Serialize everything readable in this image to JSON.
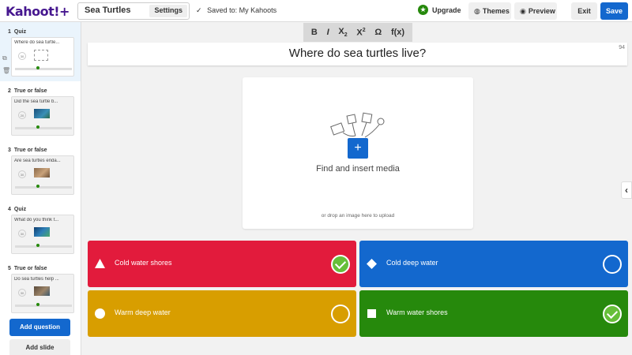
{
  "app": {
    "logo": "Kahoot!+"
  },
  "header": {
    "title": "Sea Turtles",
    "settings_label": "Settings",
    "saved_label": "Saved to: My Kahoots",
    "upgrade_label": "Upgrade",
    "themes_label": "Themes",
    "preview_label": "Preview",
    "exit_label": "Exit",
    "save_label": "Save"
  },
  "sidebar": {
    "slides": [
      {
        "number": "1",
        "type": "Quiz",
        "preview": "Where do sea turtle...",
        "timer": "30",
        "media": "placeholder"
      },
      {
        "number": "2",
        "type": "True or false",
        "preview": "Did the sea turtle b...",
        "timer": "20",
        "media": "image"
      },
      {
        "number": "3",
        "type": "True or false",
        "preview": "Are sea turtles enda...",
        "timer": "30",
        "media": "image"
      },
      {
        "number": "4",
        "type": "Quiz",
        "preview": "What do you think t...",
        "timer": "30",
        "media": "image"
      },
      {
        "number": "5",
        "type": "True or false",
        "preview": "Do sea turtles help ...",
        "timer": "30",
        "media": "image"
      }
    ],
    "add_question_label": "Add question",
    "add_slide_label": "Add slide"
  },
  "toolbar": {
    "bold": "B",
    "italic": "I",
    "subscript": "X",
    "superscript": "X",
    "omega": "Ω",
    "formula": "f(x)",
    "sub_mark": "2",
    "sup_mark": "2"
  },
  "question": {
    "text": "Where do sea turtles live?",
    "char_count": "94"
  },
  "media": {
    "label": "Find and insert media",
    "drop_hint": "or drop an image here to upload",
    "plus": "+"
  },
  "answers": [
    {
      "text": "Cold water shores",
      "shape": "triangle",
      "color": "#e21b3c",
      "correct": true
    },
    {
      "text": "Cold deep water",
      "shape": "diamond",
      "color": "#1368ce",
      "correct": false
    },
    {
      "text": "Warm deep water",
      "shape": "circle",
      "color": "#d89e00",
      "correct": false
    },
    {
      "text": "Warm water shores",
      "shape": "square",
      "color": "#26890c",
      "correct": true
    }
  ],
  "colors": {
    "primary": "#1368ce",
    "brand": "#46178f",
    "success": "#66bf39"
  }
}
